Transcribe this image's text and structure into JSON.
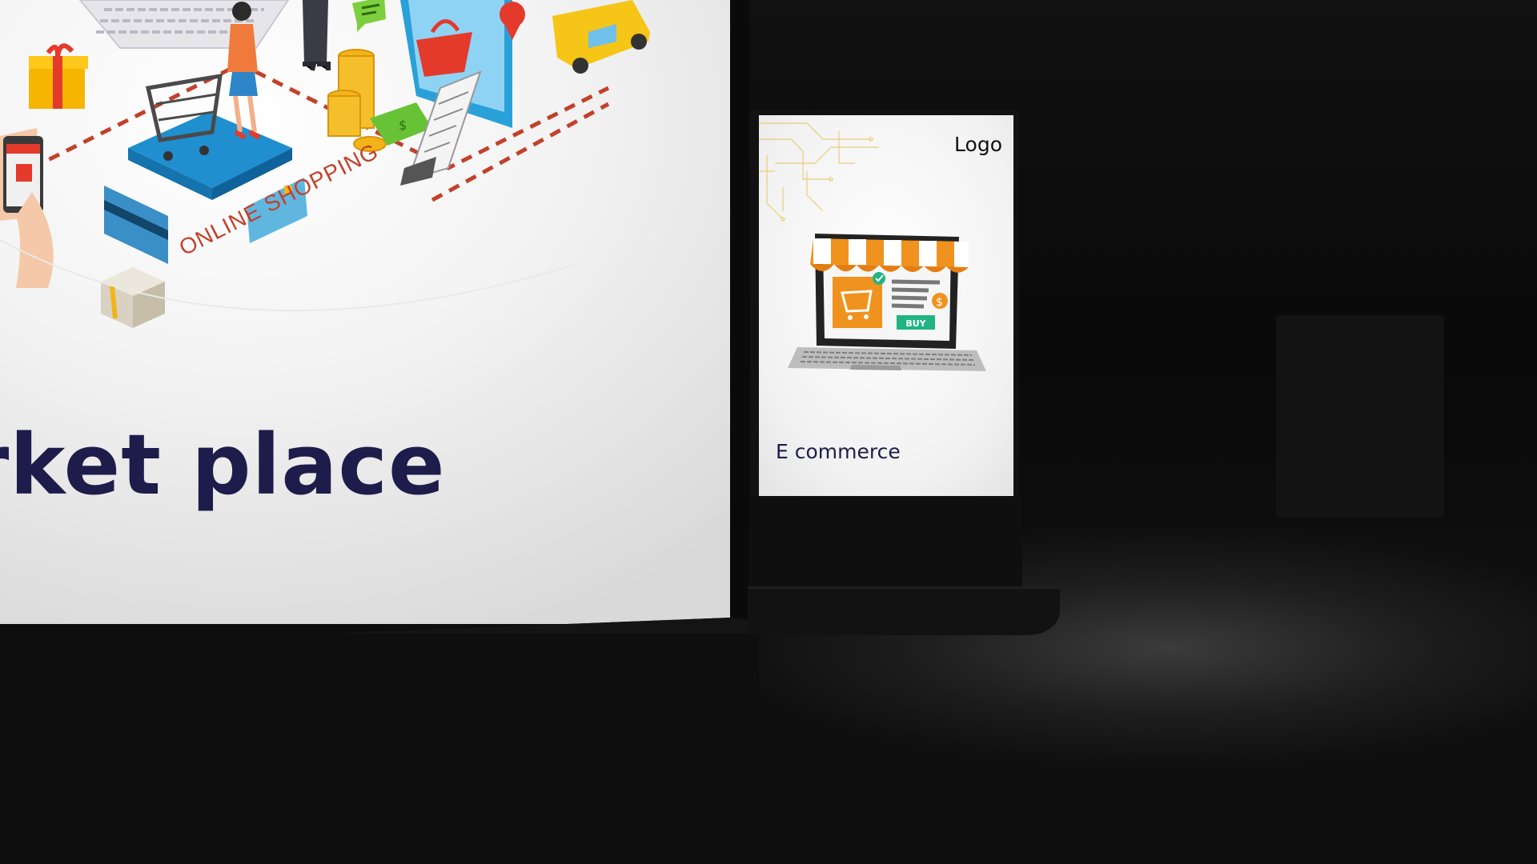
{
  "billboard": {
    "title": "rket place",
    "illustration_label": "ONLINE SHOPPING"
  },
  "poster": {
    "logo": "Logo",
    "button_label": "BUY",
    "caption": "E commerce"
  },
  "colors": {
    "title_navy": "#1e1c4a",
    "accent_orange": "#f0921e",
    "accent_red": "#c2412b",
    "buy_green": "#21b483",
    "background_dark": "#0b0b0b"
  }
}
